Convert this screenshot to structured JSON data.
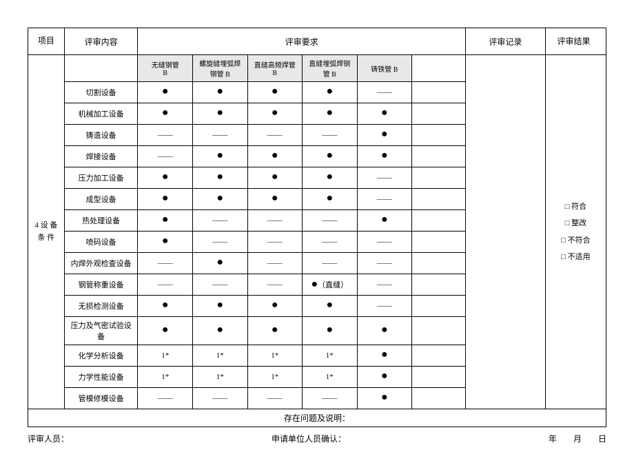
{
  "headers": {
    "c1": "项目",
    "c2": "评审内容",
    "c3": "评审要求",
    "c4": "评审记录",
    "c5": "评审结果"
  },
  "rowlabel": "4 设 备\n条 件",
  "subheads": [
    "无缝钢管\nB",
    "螺旋缝埋弧焊钢管 B",
    "直缝高频焊管 B",
    "直缝埋弧焊钢管 B",
    "铸铁管 B"
  ],
  "items": [
    {
      "name": "切割设备",
      "marks": [
        "●",
        "●",
        "●",
        "●",
        "——"
      ]
    },
    {
      "name": "机械加工设备",
      "marks": [
        "●",
        "●",
        "●",
        "●",
        "●"
      ]
    },
    {
      "name": "铸造设备",
      "marks": [
        "——",
        "——",
        "——",
        "——",
        "●"
      ]
    },
    {
      "name": "焊接设备",
      "marks": [
        "——",
        "●",
        "●",
        "●",
        "●"
      ]
    },
    {
      "name": "压力加工设备",
      "marks": [
        "●",
        "●",
        "●",
        "●",
        "——"
      ]
    },
    {
      "name": "成型设备",
      "marks": [
        "●",
        "●",
        "●",
        "●",
        "——"
      ]
    },
    {
      "name": "热处理设备",
      "marks": [
        "●",
        "——",
        "——",
        "——",
        "●"
      ]
    },
    {
      "name": "喷码设备",
      "marks": [
        "●",
        "——",
        "——",
        "——",
        "——"
      ]
    },
    {
      "name": "内焊外观检查设备",
      "marks": [
        "——",
        "●",
        "——",
        "——",
        "——"
      ]
    },
    {
      "name": "钢管称重设备",
      "marks": [
        "——",
        "——",
        "——",
        "●（直缝）",
        "——"
      ]
    },
    {
      "name": "无损检测设备",
      "marks": [
        "●",
        "●",
        "●",
        "●",
        "——"
      ]
    },
    {
      "name": "压力及气密试验设备",
      "marks": [
        "●",
        "●",
        "●",
        "●",
        "●"
      ]
    },
    {
      "name": "化学分析设备",
      "marks": [
        "1*",
        "1*",
        "1*",
        "1*",
        "●"
      ]
    },
    {
      "name": "力学性能设备",
      "marks": [
        "1*",
        "1*",
        "1*",
        "1*",
        "●"
      ]
    },
    {
      "name": "管模修模设备",
      "marks": [
        "——",
        "——",
        "——",
        "——",
        "●"
      ]
    }
  ],
  "result_opts": [
    "□ 符合",
    "□ 整改",
    "□ 不符合",
    "□ 不适用"
  ],
  "notes_label": "存在问题及说明：",
  "footer": {
    "left": "评审人员：",
    "mid": "申请单位人员确认：",
    "right": "年　　月　　日"
  }
}
